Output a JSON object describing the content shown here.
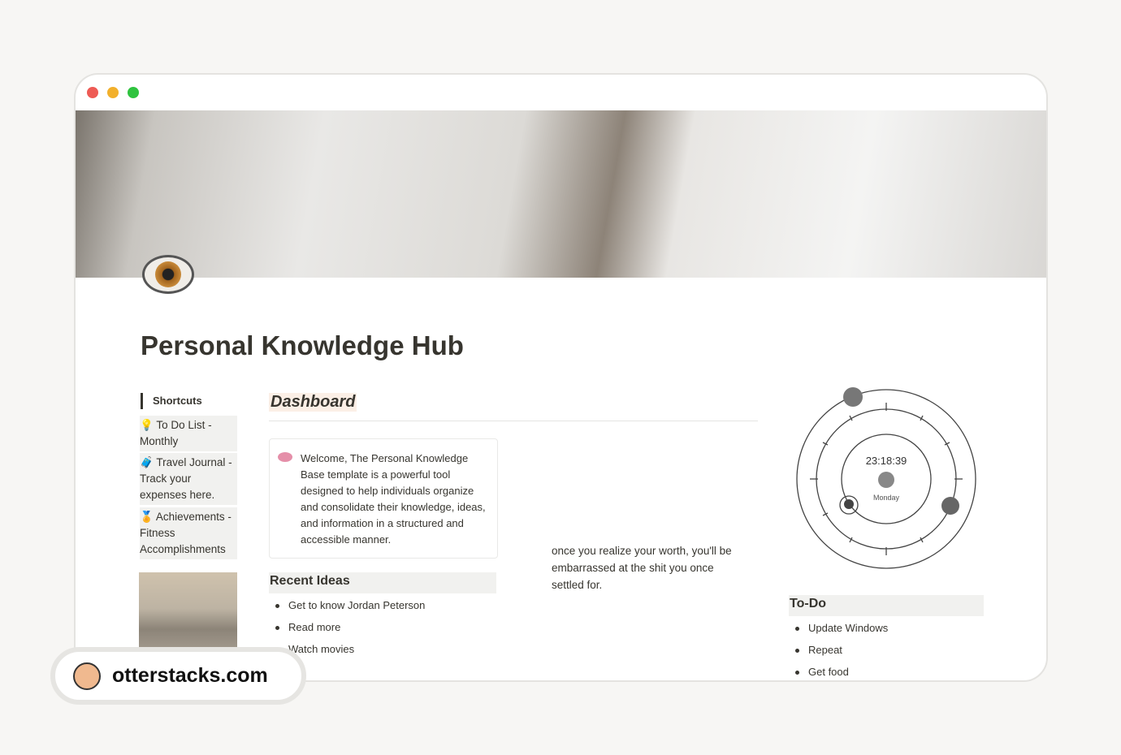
{
  "window": {
    "controls": {
      "close": "#ee5b55",
      "minimize": "#f2b02c",
      "maximize": "#2fc33f"
    }
  },
  "page": {
    "icon": "eye-emoji",
    "title": "Personal Knowledge Hub"
  },
  "shortcuts": {
    "heading": "Shortcuts",
    "items": [
      {
        "icon": "lightbulb-link-icon",
        "label": "To Do List - Monthly"
      },
      {
        "icon": "luggage-link-icon",
        "label": "Travel Journal - Track your expenses here."
      },
      {
        "icon": "medal-link-icon",
        "label": "Achievements - Fitness Accomplishments"
      }
    ]
  },
  "dashboard": {
    "heading": "Dashboard",
    "callout": {
      "icon": "brain-emoji",
      "text": "Welcome, The Personal Knowledge Base template is a powerful tool designed to help individuals organize and consolidate their knowledge, ideas, and information in a structured and accessible manner."
    },
    "recent_ideas": {
      "heading": "Recent Ideas",
      "items": [
        "Get to know Jordan Peterson",
        "Read more",
        "Watch movies"
      ]
    },
    "quote": "once you realize your worth, you'll be embarrassed at the shit you once settled for."
  },
  "clock": {
    "time": "23:18:39",
    "day": "Monday"
  },
  "todo": {
    "heading": "To-Do",
    "items": [
      "Update Windows",
      "Repeat",
      "Get food"
    ]
  },
  "watermark": {
    "text": "otterstacks.com"
  }
}
